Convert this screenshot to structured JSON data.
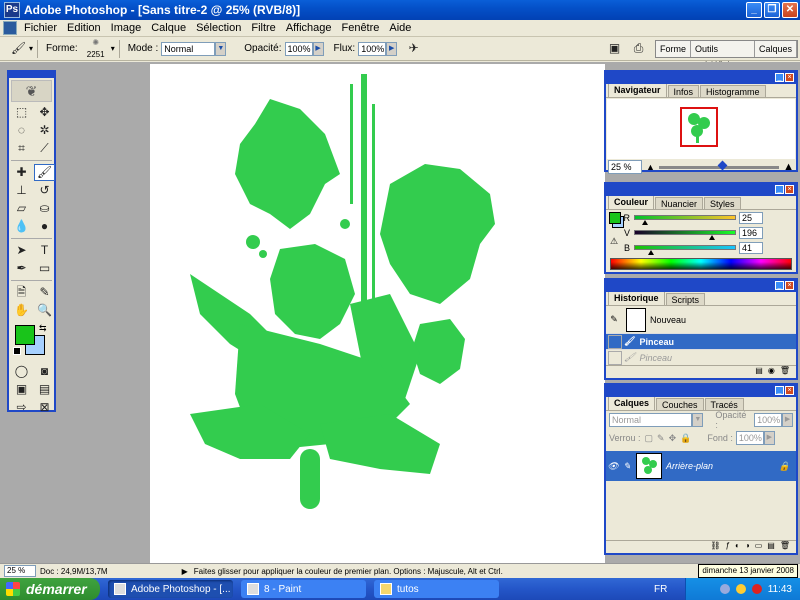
{
  "window": {
    "title": "Adobe Photoshop - [Sans titre-2 @ 25% (RVB/8)]",
    "app_icon": "Ps"
  },
  "menu": [
    "Fichier",
    "Edition",
    "Image",
    "Calque",
    "Sélection",
    "Filtre",
    "Affichage",
    "Fenêtre",
    "Aide"
  ],
  "options": {
    "forme_label": "Forme:",
    "brush_size": "2251",
    "mode_label": "Mode :",
    "mode_value": "Normal",
    "opacity_label": "Opacité:",
    "opacity_value": "100%",
    "flux_label": "Flux:",
    "flux_value": "100%",
    "well_tabs": [
      "Forme",
      "Outils prédéfinis",
      "Calques"
    ]
  },
  "colors": {
    "foreground": "#19c41a",
    "background": "#a6d0ff",
    "accent": "#1f48c7",
    "selection": "#316ac5"
  },
  "navigator": {
    "tabs": [
      "Navigateur",
      "Infos",
      "Histogramme"
    ],
    "zoom": "25 %",
    "slider_fraction": 0.5
  },
  "color_panel": {
    "tabs": [
      "Couleur",
      "Nuancier",
      "Styles"
    ],
    "channels": [
      {
        "label": "R",
        "value": "25",
        "fraction": 0.1
      },
      {
        "label": "V",
        "value": "196",
        "fraction": 0.77
      },
      {
        "label": "B",
        "value": "41",
        "fraction": 0.16
      }
    ]
  },
  "history": {
    "tabs": [
      "Historique",
      "Scripts"
    ],
    "snapshot": "Nouveau",
    "items": [
      {
        "label": "Pinceau",
        "state": "active"
      },
      {
        "label": "Pinceau",
        "state": "dim"
      }
    ]
  },
  "layers": {
    "tabs": [
      "Calques",
      "Couches",
      "Tracés"
    ],
    "mode": "Normal",
    "opacity_label": "Opacité :",
    "opacity_value": "100%",
    "lock_label": "Verrou :",
    "fill_label": "Fond :",
    "fill_value": "100%",
    "layer_name": "Arrière-plan"
  },
  "status": {
    "zoom": "25 %",
    "doc": "Doc : 24,9M/13,7M",
    "hint": "Faites glisser pour appliquer la couleur de premier plan. Options : Majuscule, Alt et Ctrl.",
    "tooltip": "dimanche 13 janvier 2008"
  },
  "taskbar": {
    "start": "démarrer",
    "tasks": [
      {
        "label": "Adobe Photoshop - [...",
        "active": true
      },
      {
        "label": "8 - Paint",
        "active": false
      },
      {
        "label": "tutos",
        "active": false
      }
    ],
    "lang": "FR",
    "clock": "11:43"
  }
}
